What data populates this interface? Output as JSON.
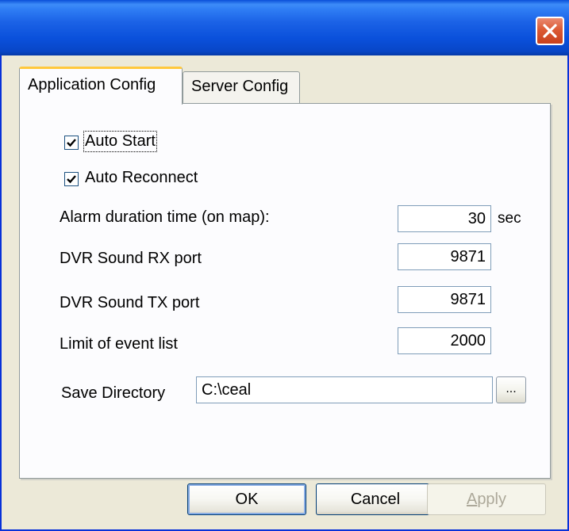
{
  "window": {
    "title": "",
    "close_icon": "close-icon"
  },
  "tabs": [
    {
      "label": "Application Config",
      "active": true
    },
    {
      "label": "Server Config",
      "active": false
    }
  ],
  "app_config": {
    "auto_start": {
      "label": "Auto Start",
      "checked": true
    },
    "auto_reconnect": {
      "label": "Auto Reconnect",
      "checked": true
    },
    "alarm_duration": {
      "label": "Alarm duration time (on map):",
      "value": "30",
      "unit": "sec"
    },
    "dvr_rx_port": {
      "label": "DVR Sound RX port",
      "value": "9871"
    },
    "dvr_tx_port": {
      "label": "DVR Sound TX port",
      "value": "9871"
    },
    "event_limit": {
      "label": "Limit of event list",
      "value": "2000"
    },
    "save_directory": {
      "label": "Save Directory",
      "value": "C:\\ceal",
      "browse_label": "..."
    }
  },
  "buttons": {
    "ok": "OK",
    "cancel": "Cancel",
    "apply": "Apply"
  },
  "colors": {
    "titlebar": "#0a50db",
    "dialog_bg": "#ece9d8",
    "tab_accent": "#ffc83c",
    "close_button": "#dc5a34"
  }
}
